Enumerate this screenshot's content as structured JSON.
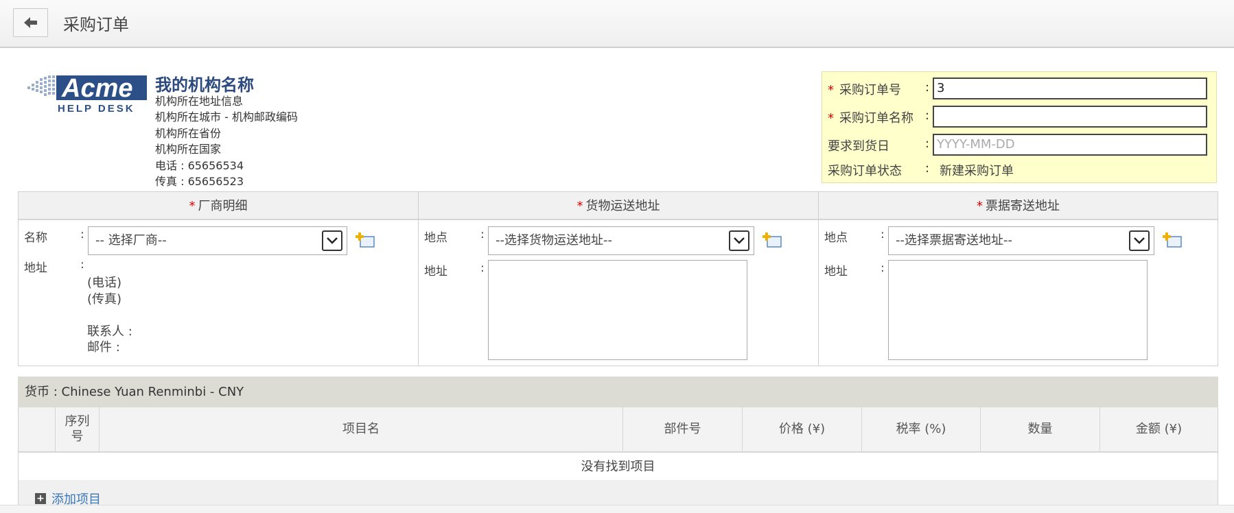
{
  "header": {
    "title": "采购订单",
    "back_icon": "arrow-left-icon"
  },
  "org": {
    "logo_text_top": "Acme",
    "logo_text_bottom": "HELP DESK",
    "name": "我的机构名称",
    "address": "机构所在地址信息",
    "city_zip": "机构所在城市 - 机构邮政编码",
    "province": "机构所在省份",
    "country": "机构所在国家",
    "phone": "电话 : 65656534",
    "fax": "传真 : 65656523"
  },
  "po": {
    "number_label": "采购订单号",
    "number_value": "3",
    "name_label": "采购订单名称",
    "name_value": "",
    "due_label": "要求到货日",
    "due_placeholder": "YYYY-MM-DD",
    "status_label": "采购订单状态",
    "status_value": "新建采购订单",
    "colon": ":",
    "required_mark": "*"
  },
  "vendor": {
    "header": "厂商明细",
    "name_label": "名称",
    "select_value": "-- 选择厂商--",
    "address_label": "地址",
    "phone": "(电话)",
    "fax": "(传真)",
    "contact": "联系人 :",
    "email": "邮件 :"
  },
  "shipping": {
    "header": "货物运送地址",
    "site_label": "地点",
    "select_value": "--选择货物运送地址--",
    "address_label": "地址"
  },
  "billing": {
    "header": "票据寄送地址",
    "site_label": "地点",
    "select_value": "--选择票据寄送地址--",
    "address_label": "地址"
  },
  "currency": {
    "text": "货币 : Chinese Yuan Renminbi - CNY"
  },
  "items": {
    "columns": [
      "",
      "序列号",
      "项目名",
      "部件号",
      "价格 (¥)",
      "税率 (%)",
      "数量",
      "金额 (¥)"
    ],
    "col_seq_line1": "序列",
    "col_seq_line2": "号",
    "empty_text": "没有找到项目",
    "add_item": "添加项目"
  }
}
